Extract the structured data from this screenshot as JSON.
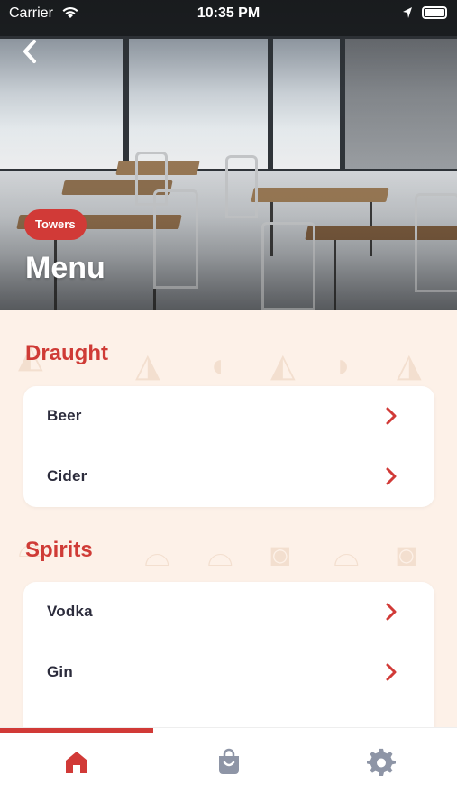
{
  "status_bar": {
    "carrier": "Carrier",
    "time": "10:35 PM"
  },
  "header": {
    "tag": "Towers",
    "title": "Menu"
  },
  "sections": [
    {
      "title": "Draught",
      "items": [
        {
          "label": "Beer"
        },
        {
          "label": "Cider"
        }
      ]
    },
    {
      "title": "Spirits",
      "items": [
        {
          "label": "Vodka"
        },
        {
          "label": "Gin"
        }
      ]
    }
  ],
  "tabs": [
    {
      "icon": "home-icon",
      "active": true
    },
    {
      "icon": "basket-icon"
    },
    {
      "icon": "settings-gear-icon"
    }
  ],
  "colors": {
    "accent": "#d13a37",
    "background": "#fdf1e8",
    "text": "#2c2c3c",
    "inactive_tab": "#8e95a6"
  }
}
